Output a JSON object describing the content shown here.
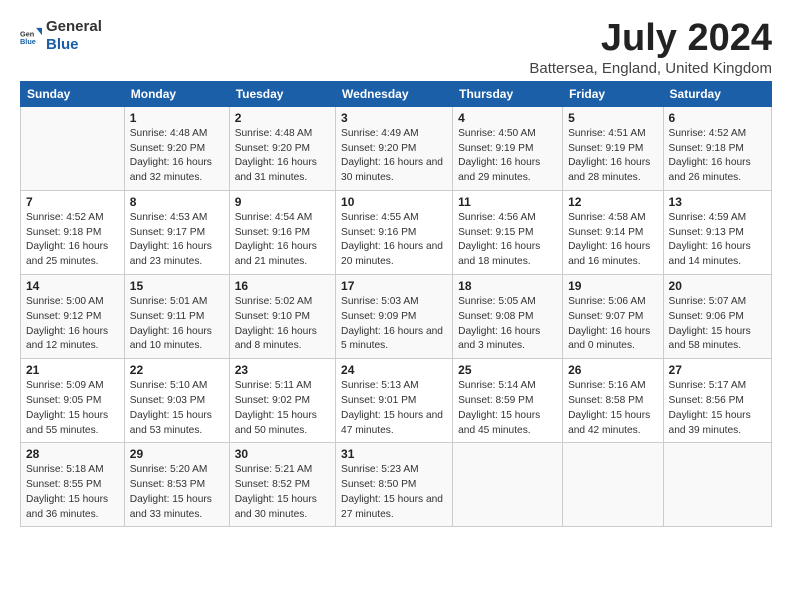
{
  "logo": {
    "general": "General",
    "blue": "Blue"
  },
  "title": "July 2024",
  "subtitle": "Battersea, England, United Kingdom",
  "columns": [
    "Sunday",
    "Monday",
    "Tuesday",
    "Wednesday",
    "Thursday",
    "Friday",
    "Saturday"
  ],
  "weeks": [
    [
      null,
      {
        "date": "1",
        "sunrise": "4:48 AM",
        "sunset": "9:20 PM",
        "daylight": "16 hours and 32 minutes."
      },
      {
        "date": "2",
        "sunrise": "4:48 AM",
        "sunset": "9:20 PM",
        "daylight": "16 hours and 31 minutes."
      },
      {
        "date": "3",
        "sunrise": "4:49 AM",
        "sunset": "9:20 PM",
        "daylight": "16 hours and 30 minutes."
      },
      {
        "date": "4",
        "sunrise": "4:50 AM",
        "sunset": "9:19 PM",
        "daylight": "16 hours and 29 minutes."
      },
      {
        "date": "5",
        "sunrise": "4:51 AM",
        "sunset": "9:19 PM",
        "daylight": "16 hours and 28 minutes."
      },
      {
        "date": "6",
        "sunrise": "4:52 AM",
        "sunset": "9:18 PM",
        "daylight": "16 hours and 26 minutes."
      }
    ],
    [
      {
        "date": "7",
        "sunrise": "4:52 AM",
        "sunset": "9:18 PM",
        "daylight": "16 hours and 25 minutes."
      },
      {
        "date": "8",
        "sunrise": "4:53 AM",
        "sunset": "9:17 PM",
        "daylight": "16 hours and 23 minutes."
      },
      {
        "date": "9",
        "sunrise": "4:54 AM",
        "sunset": "9:16 PM",
        "daylight": "16 hours and 21 minutes."
      },
      {
        "date": "10",
        "sunrise": "4:55 AM",
        "sunset": "9:16 PM",
        "daylight": "16 hours and 20 minutes."
      },
      {
        "date": "11",
        "sunrise": "4:56 AM",
        "sunset": "9:15 PM",
        "daylight": "16 hours and 18 minutes."
      },
      {
        "date": "12",
        "sunrise": "4:58 AM",
        "sunset": "9:14 PM",
        "daylight": "16 hours and 16 minutes."
      },
      {
        "date": "13",
        "sunrise": "4:59 AM",
        "sunset": "9:13 PM",
        "daylight": "16 hours and 14 minutes."
      }
    ],
    [
      {
        "date": "14",
        "sunrise": "5:00 AM",
        "sunset": "9:12 PM",
        "daylight": "16 hours and 12 minutes."
      },
      {
        "date": "15",
        "sunrise": "5:01 AM",
        "sunset": "9:11 PM",
        "daylight": "16 hours and 10 minutes."
      },
      {
        "date": "16",
        "sunrise": "5:02 AM",
        "sunset": "9:10 PM",
        "daylight": "16 hours and 8 minutes."
      },
      {
        "date": "17",
        "sunrise": "5:03 AM",
        "sunset": "9:09 PM",
        "daylight": "16 hours and 5 minutes."
      },
      {
        "date": "18",
        "sunrise": "5:05 AM",
        "sunset": "9:08 PM",
        "daylight": "16 hours and 3 minutes."
      },
      {
        "date": "19",
        "sunrise": "5:06 AM",
        "sunset": "9:07 PM",
        "daylight": "16 hours and 0 minutes."
      },
      {
        "date": "20",
        "sunrise": "5:07 AM",
        "sunset": "9:06 PM",
        "daylight": "15 hours and 58 minutes."
      }
    ],
    [
      {
        "date": "21",
        "sunrise": "5:09 AM",
        "sunset": "9:05 PM",
        "daylight": "15 hours and 55 minutes."
      },
      {
        "date": "22",
        "sunrise": "5:10 AM",
        "sunset": "9:03 PM",
        "daylight": "15 hours and 53 minutes."
      },
      {
        "date": "23",
        "sunrise": "5:11 AM",
        "sunset": "9:02 PM",
        "daylight": "15 hours and 50 minutes."
      },
      {
        "date": "24",
        "sunrise": "5:13 AM",
        "sunset": "9:01 PM",
        "daylight": "15 hours and 47 minutes."
      },
      {
        "date": "25",
        "sunrise": "5:14 AM",
        "sunset": "8:59 PM",
        "daylight": "15 hours and 45 minutes."
      },
      {
        "date": "26",
        "sunrise": "5:16 AM",
        "sunset": "8:58 PM",
        "daylight": "15 hours and 42 minutes."
      },
      {
        "date": "27",
        "sunrise": "5:17 AM",
        "sunset": "8:56 PM",
        "daylight": "15 hours and 39 minutes."
      }
    ],
    [
      {
        "date": "28",
        "sunrise": "5:18 AM",
        "sunset": "8:55 PM",
        "daylight": "15 hours and 36 minutes."
      },
      {
        "date": "29",
        "sunrise": "5:20 AM",
        "sunset": "8:53 PM",
        "daylight": "15 hours and 33 minutes."
      },
      {
        "date": "30",
        "sunrise": "5:21 AM",
        "sunset": "8:52 PM",
        "daylight": "15 hours and 30 minutes."
      },
      {
        "date": "31",
        "sunrise": "5:23 AM",
        "sunset": "8:50 PM",
        "daylight": "15 hours and 27 minutes."
      },
      null,
      null,
      null
    ]
  ]
}
